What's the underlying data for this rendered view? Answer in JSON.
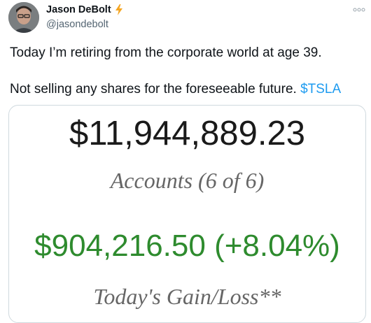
{
  "tweet": {
    "author": {
      "name": "Jason DeBolt",
      "handle": "@jasondebolt",
      "badge_icon": "lightning-bolt-icon",
      "badge_color": "#f5a623"
    },
    "more_icon": "more-dots-icon",
    "text_line1": "Today I’m retiring from the corporate world at age 39.",
    "text_line2_prefix": "Not selling any shares for the foreseeable future. ",
    "cashtag": "$TSLA",
    "cashtag_color": "#1d9bf0"
  },
  "media": {
    "balance": "$11,944,889.23",
    "accounts_label": "Accounts (6 of 6)",
    "gain": "$904,216.50 (+8.04%)",
    "gain_color": "#2e8b2e",
    "gain_label": "Today's Gain/Loss**"
  }
}
